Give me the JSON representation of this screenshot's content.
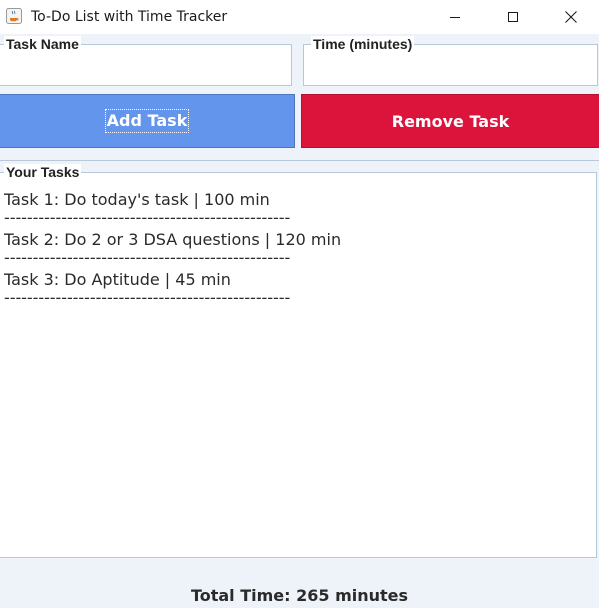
{
  "window": {
    "title": "To-Do List with Time Tracker",
    "icon": "java-app-icon",
    "controls": [
      "minimize-icon",
      "maximize-icon",
      "close-icon"
    ]
  },
  "inputs": {
    "task_name": {
      "label": "Task Name",
      "value": ""
    },
    "time_minutes": {
      "label": "Time (minutes)",
      "value": ""
    }
  },
  "buttons": {
    "add_task": {
      "label": "Add Task",
      "color": "#6495ED"
    },
    "remove_task": {
      "label": "Remove Task",
      "color": "#DC143C"
    }
  },
  "tasks_panel": {
    "title": "Your Tasks",
    "items": [
      {
        "text": "Task 1: Do today's task | 100 min"
      },
      {
        "text": "Task 2: Do 2 or 3 DSA questions | 120 min"
      },
      {
        "text": "Task 3: Do Aptitude | 45 min"
      }
    ],
    "separator": "--------------------------------------------------"
  },
  "footer": {
    "total_time": "Total Time: 265 minutes"
  }
}
